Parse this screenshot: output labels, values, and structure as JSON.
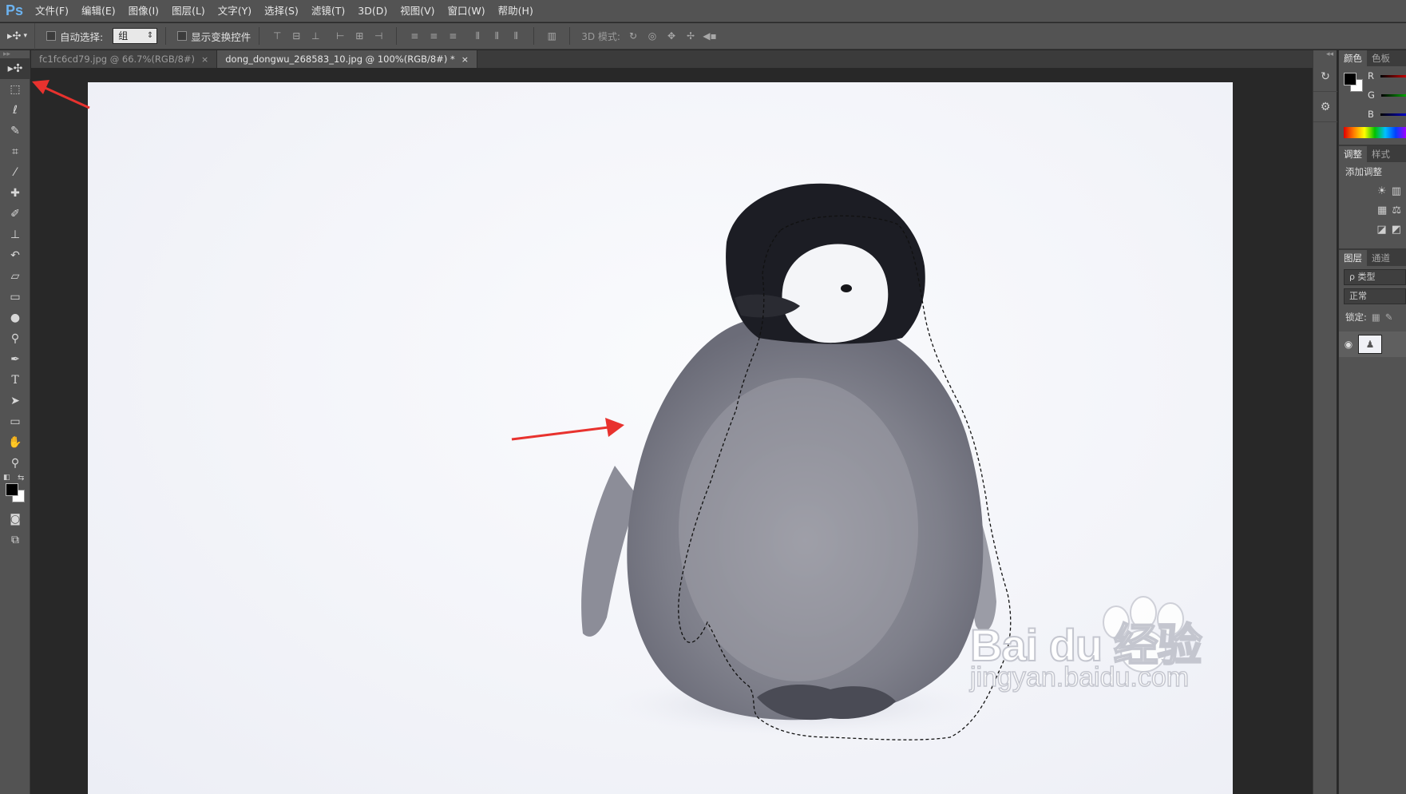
{
  "app": {
    "logo": "Ps"
  },
  "menu": [
    "文件(F)",
    "编辑(E)",
    "图像(I)",
    "图层(L)",
    "文字(Y)",
    "选择(S)",
    "滤镜(T)",
    "3D(D)",
    "视图(V)",
    "窗口(W)",
    "帮助(H)"
  ],
  "options_bar": {
    "auto_select_label": "自动选择:",
    "auto_select_value": "组",
    "show_transform_label": "显示变换控件",
    "mode_3d_label": "3D 模式:"
  },
  "tabs": [
    {
      "title": "fc1fc6cd79.jpg @ 66.7%(RGB/8#)",
      "close": "×"
    },
    {
      "title": "dong_dongwu_268583_10.jpg @ 100%(RGB/8#) *",
      "close": "×"
    }
  ],
  "color_panel": {
    "tabs": [
      "颜色",
      "色板"
    ],
    "channels": [
      "R",
      "G",
      "B"
    ]
  },
  "adjust_panel": {
    "tabs": [
      "调整",
      "样式"
    ],
    "add_label": "添加调整"
  },
  "layers_panel": {
    "tabs": [
      "图层",
      "通道"
    ],
    "filter_label": "ρ 类型",
    "blend_mode": "正常",
    "lock_label": "锁定:"
  },
  "watermark": {
    "brand": "Bai du 经验",
    "url": "jingyan.baidu.com"
  },
  "colors": {
    "accent_arrow": "#e8322e",
    "ps_blue": "#6cb3f0"
  }
}
